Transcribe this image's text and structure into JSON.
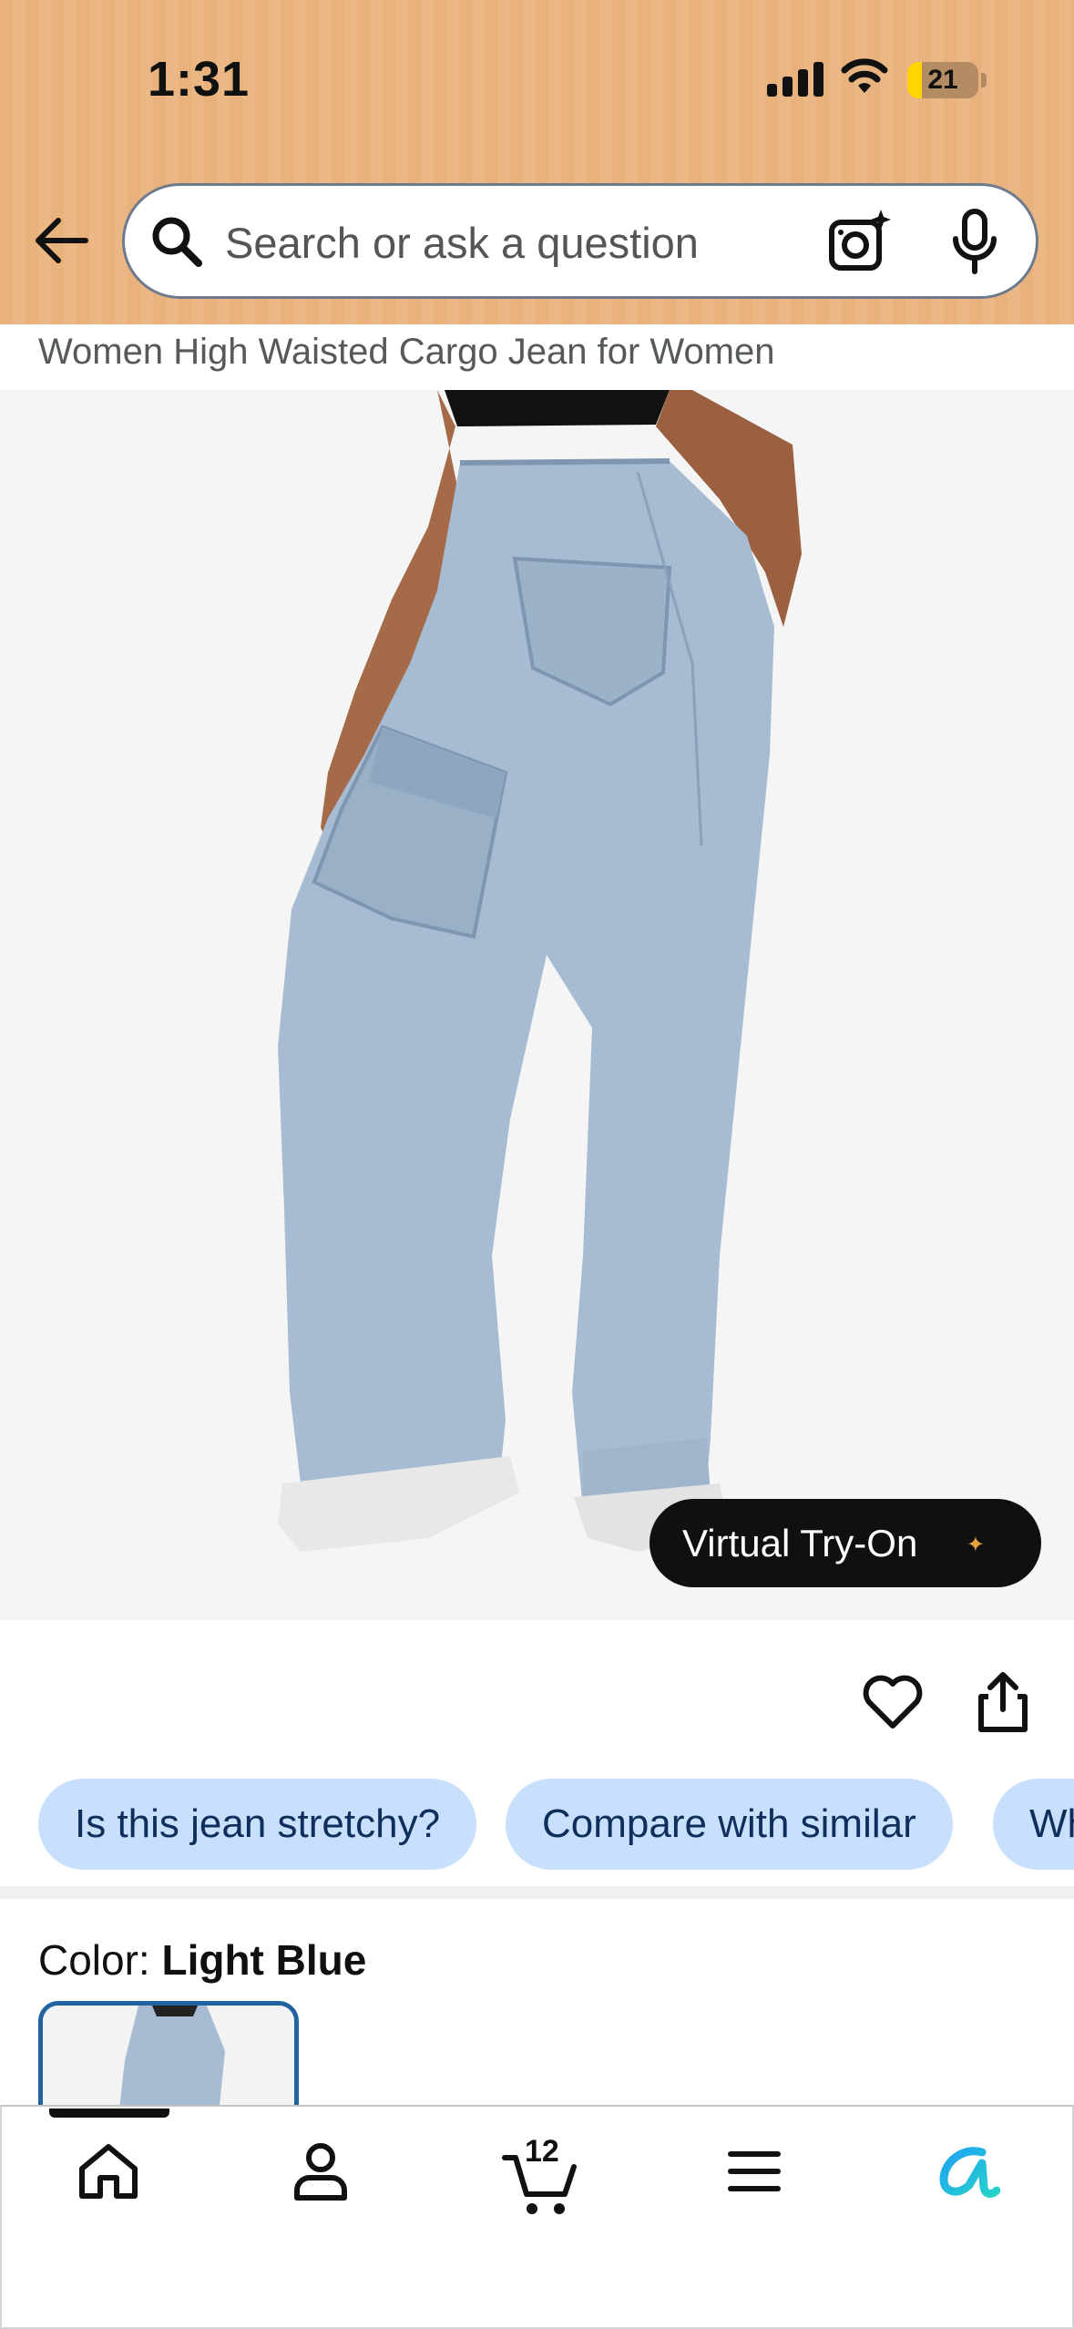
{
  "status_bar": {
    "time": "1:31",
    "battery_level": "21",
    "battery_fraction": 0.21
  },
  "search": {
    "placeholder": "Search or ask a question"
  },
  "product": {
    "title_fragment": "Women High Waisted Cargo Jean for Women",
    "virtual_try_on_label": "Virtual Try-On"
  },
  "question_chips": [
    "Is this jean stretchy?",
    "Compare with similar",
    "Wh"
  ],
  "color": {
    "label": "Color: ",
    "value": "Light Blue"
  },
  "nav": {
    "cart_count": "12"
  },
  "colors": {
    "header_orange": "#e9b27d",
    "chip_blue": "#c8e0fb",
    "chip_text": "#0f2e5c",
    "swatch_border": "#2162a1",
    "battery_yellow": "#ffd400",
    "alexa_blue": "#1ea3f5"
  },
  "icons": [
    "back-arrow-icon",
    "search-icon",
    "camera-lens-icon",
    "microphone-icon",
    "heart-icon",
    "share-icon",
    "home-icon",
    "account-icon",
    "cart-icon",
    "menu-icon",
    "rufus-icon"
  ]
}
